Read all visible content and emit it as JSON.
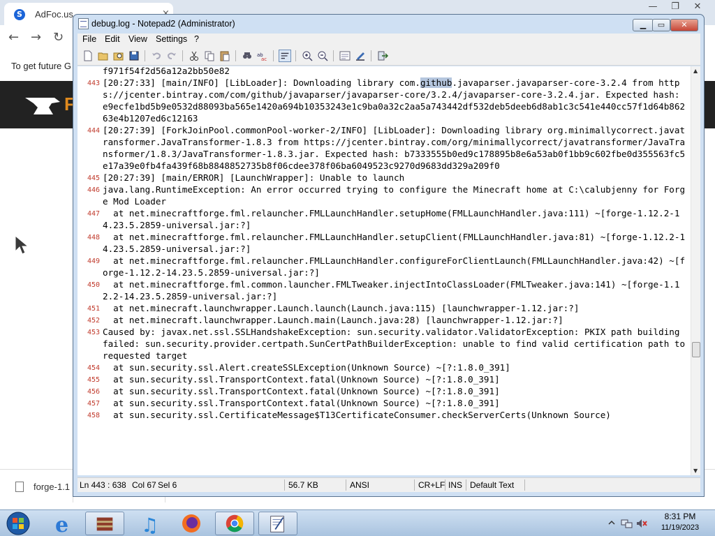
{
  "browser": {
    "tab_title": "AdFoc.us",
    "tab_close": "×",
    "window_controls": [
      "—",
      "❐",
      "✕"
    ],
    "nav_back": "←",
    "nav_forward": "→",
    "nav_reload": "↻",
    "info_text": "To get future G",
    "banner_letter": "F",
    "download_item": "forge-1.1"
  },
  "notepad": {
    "title": "debug.log - Notepad2 (Administrator)",
    "menu": [
      "File",
      "Edit",
      "View",
      "Settings",
      "?"
    ],
    "highlight_word": "github",
    "lines": [
      {
        "n": "",
        "text": "f971f54f2d56a12a2bb50e82"
      },
      {
        "n": "443",
        "pre": "[20:27:33] [main/INFO] [LibLoader]: Downloading library com.",
        "hl": "github",
        "post": ".javaparser.javaparser-core-3.2.4 from https://jcenter.bintray.com/com/github/javaparser/javaparser-core/3.2.4/javaparser-core-3.2.4.jar. Expected hash: e9ecfe1bd5b9e0532d88093ba565e1420a694b10353243e1c9ba0a32c2aa5a743442df532deb5deeb6d8ab1c3c541e440cc57f1d64b86263e4b1207ed6c12163"
      },
      {
        "n": "444",
        "text": "[20:27:39] [ForkJoinPool.commonPool-worker-2/INFO] [LibLoader]: Downloading library org.minimallycorrect.javatransformer.JavaTransformer-1.8.3 from https://jcenter.bintray.com/org/minimallycorrect/javatransformer/JavaTransformer/1.8.3/JavaTransformer-1.8.3.jar. Expected hash: b7333555b0ed9c178895b8e6a53ab0f1bb9c602fbe0d355563fc5e17a39e0fb4fa439f68b8848852735b8f06cdee378f06ba6049523c9270d9683dd329a209f0"
      },
      {
        "n": "445",
        "text": "[20:27:39] [main/ERROR] [LaunchWrapper]: Unable to launch"
      },
      {
        "n": "446",
        "text": "java.lang.RuntimeException: An error occurred trying to configure the Minecraft home at C:\\calubjenny for Forge Mod Loader"
      },
      {
        "n": "447",
        "text": "  at net.minecraftforge.fml.relauncher.FMLLaunchHandler.setupHome(FMLLaunchHandler.java:111) ~[forge-1.12.2-14.23.5.2859-universal.jar:?]"
      },
      {
        "n": "448",
        "text": "  at net.minecraftforge.fml.relauncher.FMLLaunchHandler.setupClient(FMLLaunchHandler.java:81) ~[forge-1.12.2-14.23.5.2859-universal.jar:?]"
      },
      {
        "n": "449",
        "text": "  at net.minecraftforge.fml.relauncher.FMLLaunchHandler.configureForClientLaunch(FMLLaunchHandler.java:42) ~[forge-1.12.2-14.23.5.2859-universal.jar:?]"
      },
      {
        "n": "450",
        "text": "  at net.minecraftforge.fml.common.launcher.FMLTweaker.injectIntoClassLoader(FMLTweaker.java:141) ~[forge-1.12.2-14.23.5.2859-universal.jar:?]"
      },
      {
        "n": "451",
        "text": "  at net.minecraft.launchwrapper.Launch.launch(Launch.java:115) [launchwrapper-1.12.jar:?]"
      },
      {
        "n": "452",
        "text": "  at net.minecraft.launchwrapper.Launch.main(Launch.java:28) [launchwrapper-1.12.jar:?]"
      },
      {
        "n": "453",
        "text": "Caused by: javax.net.ssl.SSLHandshakeException: sun.security.validator.ValidatorException: PKIX path building failed: sun.security.provider.certpath.SunCertPathBuilderException: unable to find valid certification path to requested target"
      },
      {
        "n": "454",
        "text": "  at sun.security.ssl.Alert.createSSLException(Unknown Source) ~[?:1.8.0_391]"
      },
      {
        "n": "455",
        "text": "  at sun.security.ssl.TransportContext.fatal(Unknown Source) ~[?:1.8.0_391]"
      },
      {
        "n": "456",
        "text": "  at sun.security.ssl.TransportContext.fatal(Unknown Source) ~[?:1.8.0_391]"
      },
      {
        "n": "457",
        "text": "  at sun.security.ssl.TransportContext.fatal(Unknown Source) ~[?:1.8.0_391]"
      },
      {
        "n": "458",
        "text": "  at sun.security.ssl.CertificateMessage$T13CertificateConsumer.checkServerCerts(Unknown Source)"
      }
    ],
    "status": {
      "position": "Ln 443 : 638",
      "col": "Col 67",
      "sel": "Sel 6",
      "size": "56.7 KB",
      "encoding": "ANSI",
      "eol": "CR+LF",
      "ins": "INS",
      "scheme": "Default Text"
    }
  },
  "taskbar": {
    "time": "8:31 PM",
    "date": "11/19/2023"
  },
  "colors": {
    "line_number": "#c0392b",
    "selection": "#b5c6de",
    "title_bar": "#cfe0f3",
    "banner": "#222222",
    "banner_accent": "#e08a1e"
  }
}
